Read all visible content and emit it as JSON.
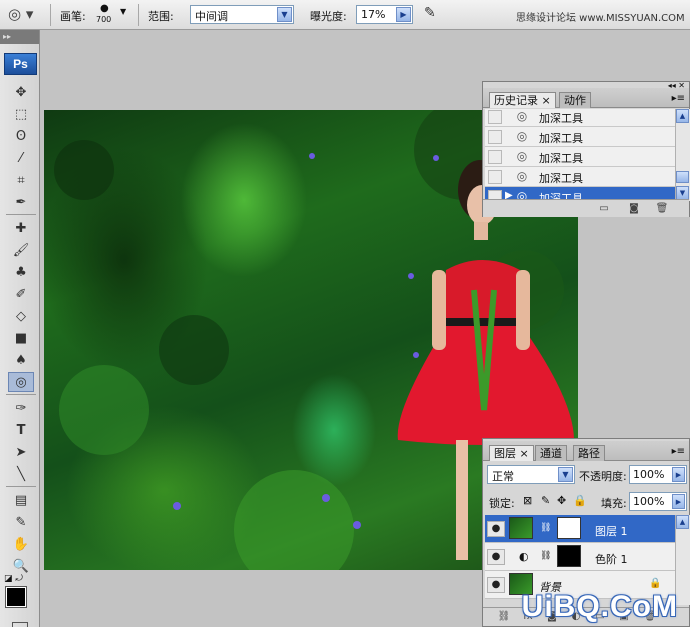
{
  "options_bar": {
    "brush_label": "画笔:",
    "brush_size": "700",
    "range_label": "范围:",
    "range_value": "中间调",
    "exposure_label": "曝光度:",
    "exposure_value": "17%",
    "site_text": "思缘设计论坛 www.MISSYUAN.COM"
  },
  "toolbox": {
    "logo": "Ps",
    "tools": [
      "move-icon",
      "marquee-icon",
      "lasso-icon",
      "magic-wand-icon",
      "crop-icon",
      "eyedropper-slice-icon",
      "healing-brush-icon",
      "brush-icon",
      "clone-stamp-icon",
      "history-brush-icon",
      "eraser-icon",
      "gradient-icon",
      "blur-icon",
      "burn-icon",
      "pen-icon",
      "type-icon",
      "path-select-icon",
      "line-icon",
      "notes-icon",
      "eyedropper-icon",
      "hand-icon",
      "zoom-icon"
    ]
  },
  "history_panel": {
    "tabs": [
      {
        "label": "历史记录 ×"
      },
      {
        "label": "动作"
      }
    ],
    "items": [
      {
        "label": "加深工具"
      },
      {
        "label": "加深工具"
      },
      {
        "label": "加深工具"
      },
      {
        "label": "加深工具"
      },
      {
        "label": "加深工具"
      }
    ]
  },
  "layers_panel": {
    "tabs": [
      {
        "label": "图层 ×"
      },
      {
        "label": "通道"
      },
      {
        "label": "路径"
      }
    ],
    "blend_mode": "正常",
    "opacity_label": "不透明度:",
    "opacity_value": "100%",
    "lock_label": "锁定:",
    "fill_label": "填充:",
    "fill_value": "100%",
    "layers": [
      {
        "name": "图层 1"
      },
      {
        "name": "色阶 1"
      },
      {
        "name": "背景"
      }
    ]
  },
  "watermark": "UiBQ.CoM",
  "colors": {
    "selection": "#3168c6",
    "panel_bg": "#d6d6d6",
    "workspace": "#c3c3c3"
  }
}
